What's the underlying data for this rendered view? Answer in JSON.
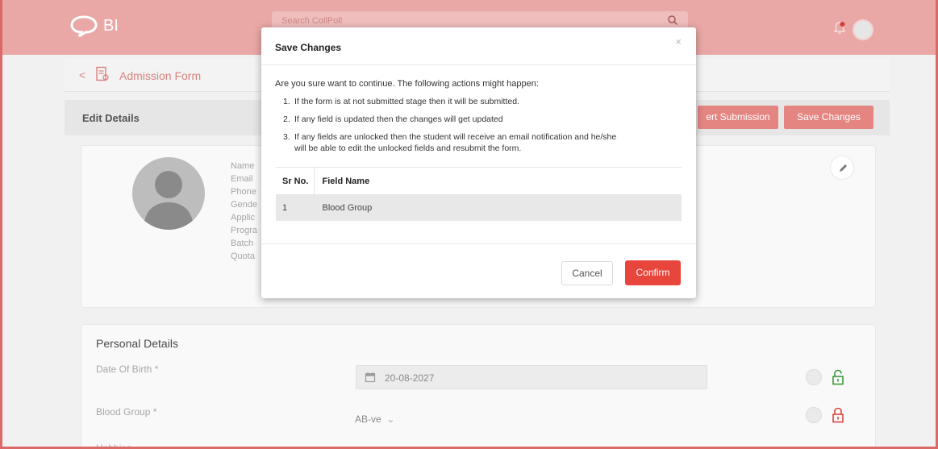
{
  "topbar": {
    "logo_text": "BI",
    "search_placeholder": "Search CollPoll"
  },
  "subheader": {
    "back_label": "<",
    "title": "Admission Form"
  },
  "editbar": {
    "title": "Edit Details",
    "revert_label": "ert Submission",
    "save_label": "Save Changes"
  },
  "profile": {
    "labels": [
      "Name",
      "Email",
      "Phone",
      "Gende",
      "Applic",
      "Progra",
      "Batch",
      "Quota"
    ]
  },
  "personal": {
    "section_title": "Personal Details",
    "dob_label": "Date Of Birth *",
    "dob_value": "20-08-2027",
    "blood_label": "Blood Group *",
    "blood_value": "AB-ve",
    "hobbies_label": "Hobbies"
  },
  "modal": {
    "title": "Save Changes",
    "close": "×",
    "intro": "Are you sure want to continue. The following actions might happen:",
    "points": [
      {
        "num": "1.",
        "text": "If the form is at not submitted stage then it will be submitted."
      },
      {
        "num": "2.",
        "text": "If any field is updated then the changes will get updated"
      },
      {
        "num": "3.",
        "text": "If any fields are unlocked then the student will receive an email notification and he/she",
        "cont": "will be able to edit the unlocked fields and resubmit the form."
      }
    ],
    "table": {
      "headers": [
        "Sr No.",
        "Field Name"
      ],
      "rows": [
        [
          "1",
          "Blood Group"
        ]
      ]
    },
    "cancel_label": "Cancel",
    "confirm_label": "Confirm"
  },
  "colors": {
    "brand_red": "#e8453c",
    "dimmed_red": "#e58582"
  }
}
